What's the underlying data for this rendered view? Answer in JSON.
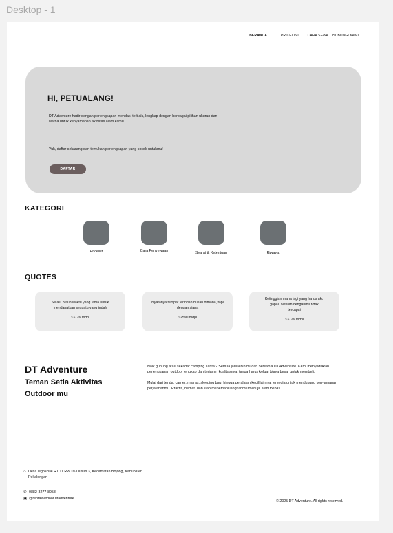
{
  "frame_label": "Desktop - 1",
  "nav": {
    "items": [
      "BERANDA",
      "PRICELIST",
      "CARA SEWA",
      "HUBUNGI KAMI"
    ]
  },
  "hero": {
    "title": "HI, PETUALANG!",
    "description": "DT Adventure hadir dengan perlengkapan mendaki terbaik, lengkap dengan berbagai pilihan ukuran dan warna untuk kenyamanan aktivitas alam kamu.",
    "cta_text": "Yuk, daftar sekarang dan temukan perlengkapan yang cocok untukmu!",
    "button_label": "DAFTAR"
  },
  "kategori": {
    "title": "KATEGORI",
    "items": [
      {
        "label": "Pricelist"
      },
      {
        "label": "Cara Penyewaan"
      },
      {
        "label": "Syarat & Ketentuan"
      },
      {
        "label": "Riwayat"
      }
    ]
  },
  "quotes": {
    "title": "QUOTES",
    "items": [
      {
        "text": "Selalu butuh waktu yang lama untuk mendapatkan sesuatu yang indah",
        "author": "~3726 mdpl"
      },
      {
        "text": "Nyatanya tempat terindah bukan dimana, tapi dengan siapa",
        "author": "~2590 mdpl"
      },
      {
        "text": "Ketinggian mana lagi yang harus aku gapai, setelah denganmu tidak tercapai",
        "author": "~3726 mdpl"
      }
    ]
  },
  "brand": {
    "title": "DT Adventure",
    "subtitle": "Teman Setia Aktivitas Outdoor mu",
    "about_1": "Naik gunung atau sekadar camping santai? Semua jadi lebih mudah bersama DT Adventure. Kami menyediakan perlengkapan outdoor lengkap dan terjamin kualitasnya, tanpa harus keluar biaya besar untuk membeli.",
    "about_2": "Mulai dari tenda, carrier, matras, sleeping bag, hingga peralatan kecil lainnya tersedia untuk mendukung kenyamanan perjalananmu. Praktis, hemat, dan siap menemani langkahmu menuju alam bebas."
  },
  "footer": {
    "address": "Desa legokclile RT 11 RW 05 Dusun 3, Kecamatan Bojong, Kabupaten Pekalongan",
    "phone": "0882-3277-8958",
    "instagram": "@rentaloutdoor.dtadventure",
    "copyright": "© 2025 DT Adventure. All rights reserved.",
    "icons": {
      "address": "home-icon",
      "phone": "phone-icon",
      "instagram": "instagram-icon"
    }
  }
}
